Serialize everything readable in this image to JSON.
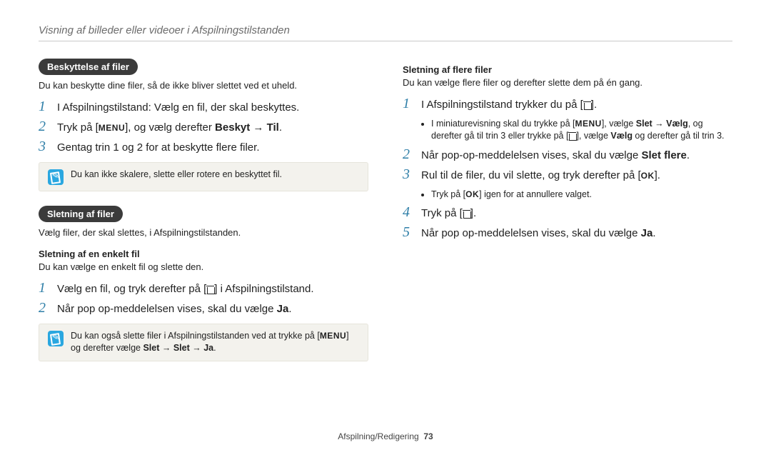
{
  "header": "Visning af billeder eller videoer i Afspilningstilstanden",
  "footer": {
    "label": "Afspilning/Redigering",
    "page": "73"
  },
  "left": {
    "protection": {
      "title": "Beskyttelse af filer",
      "intro": "Du kan beskytte dine filer, så de ikke bliver slettet ved et uheld.",
      "steps": [
        "I Afspilningstilstand: Vælg en fil, der skal beskyttes.",
        "Tryk på [MENU], og vælg derefter Beskyt → Til.",
        "Gentag trin 1 og 2 for at beskytte flere filer."
      ],
      "note": "Du kan ikke skalere, slette eller rotere en beskyttet fil."
    },
    "delete": {
      "title": "Sletning af filer",
      "intro": "Vælg filer, der skal slettes, i Afspilningstilstanden.",
      "single_head": "Sletning af en enkelt fil",
      "single_intro": "Du kan vælge en enkelt fil og slette den.",
      "steps": [
        "Vælg en fil, og tryk derefter på [trash] i Afspilningstilstand.",
        "Når pop op-meddelelsen vises, skal du vælge Ja."
      ],
      "note": "Du kan også slette filer i Afspilningstilstanden ved at trykke på [MENU] og derefter vælge Slet → Slet → Ja."
    }
  },
  "right": {
    "multi_head": "Sletning af flere filer",
    "multi_intro": "Du kan vælge flere filer og derefter slette dem på én gang.",
    "steps": {
      "1": "I Afspilningstilstand trykker du på [trash].",
      "1_bullet": "I miniaturevisning skal du trykke på [MENU], vælge Slet → Vælg, og derefter gå til trin 3 eller trykke på [trash], vælge Vælg og derefter gå til trin 3.",
      "2": "Når pop-op-meddelelsen vises, skal du vælge Slet flere.",
      "3": "Rul til de filer, du vil slette, og tryk derefter på [OK].",
      "3_bullet": "Tryk på [OK] igen for at annullere valget.",
      "4": "Tryk på [trash].",
      "5": "Når pop op-meddelelsen vises, skal du vælge Ja."
    }
  }
}
